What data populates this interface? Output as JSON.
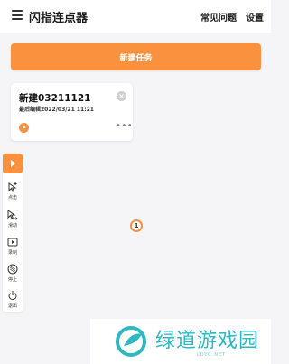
{
  "header": {
    "title": "闪指连点器",
    "faq_label": "常见问题",
    "settings_label": "设置"
  },
  "actions": {
    "new_task_label": "新建任务"
  },
  "task": {
    "name": "新建03211121",
    "last_edit": "最后编辑2022/03/21 11:21"
  },
  "toolbar": {
    "items": [
      {
        "icon": "add-click-icon",
        "label": "点击"
      },
      {
        "icon": "swipe-icon",
        "label": "滑动"
      },
      {
        "icon": "record-icon",
        "label": "录制"
      },
      {
        "icon": "stop-icon",
        "label": "停止"
      },
      {
        "icon": "exit-icon",
        "label": "退出"
      }
    ]
  },
  "click_point": {
    "number": "1"
  },
  "watermark": {
    "text": "绿道游戏园",
    "sub": "LDYC.NET"
  },
  "colors": {
    "accent": "#f9913f",
    "background": "#f5f5f7",
    "watermark": "#2fb7c4"
  }
}
